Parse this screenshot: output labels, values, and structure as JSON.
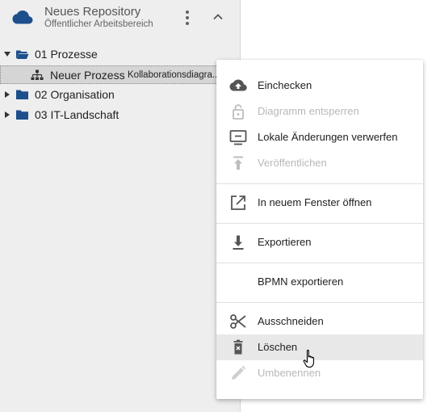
{
  "repository": {
    "title": "Neues Repository",
    "subtitle": "Öffentlicher Arbeitsbereich"
  },
  "tree": {
    "items": [
      {
        "label": "01 Prozesse",
        "expanded": true
      },
      {
        "label": "02 Organisation",
        "expanded": false
      },
      {
        "label": "03 IT-Landschaft",
        "expanded": false
      }
    ],
    "selected": {
      "label": "Neuer Prozess",
      "type": "Kollaborationsdiagra..."
    }
  },
  "context_menu": {
    "items": [
      {
        "label": "Einchecken",
        "icon": "cloud-upload-icon",
        "enabled": true
      },
      {
        "label": "Diagramm entsperren",
        "icon": "unlock-icon",
        "enabled": false
      },
      {
        "label": "Lokale Änderungen verwerfen",
        "icon": "monitor-minus-icon",
        "enabled": true
      },
      {
        "label": "Veröffentlichen",
        "icon": "publish-icon",
        "enabled": false
      },
      {
        "label": "In neuem Fenster öffnen",
        "icon": "open-in-new-icon",
        "enabled": true
      },
      {
        "label": "Exportieren",
        "icon": "download-icon",
        "enabled": true
      },
      {
        "label": "BPMN exportieren",
        "icon": "",
        "enabled": true
      },
      {
        "label": "Ausschneiden",
        "icon": "scissors-icon",
        "enabled": true
      },
      {
        "label": "Löschen",
        "icon": "trash-icon",
        "enabled": true,
        "hovered": true
      },
      {
        "label": "Umbenennen",
        "icon": "pencil-icon",
        "enabled": false
      }
    ]
  },
  "colors": {
    "accent": "#1d4f8c",
    "panel_bg": "#eeeeee",
    "icon": "#555555",
    "disabled": "#bdbdbd"
  }
}
